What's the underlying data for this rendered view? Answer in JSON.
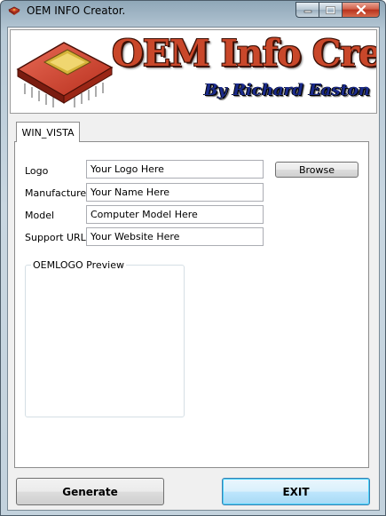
{
  "window": {
    "title": "OEM INFO Creator."
  },
  "banner": {
    "title": "OEM Info Creator",
    "subtitle": "By Richard Easton"
  },
  "tabs": [
    {
      "label": "WIN_VISTA",
      "selected": true
    }
  ],
  "form": {
    "logo": {
      "label": "Logo",
      "value": "Your Logo Here"
    },
    "manufacturer": {
      "label": "Manufacturer",
      "value": "Your Name Here"
    },
    "model": {
      "label": "Model",
      "value": "Computer Model Here"
    },
    "support_url": {
      "label": "Support URL",
      "value": "Your Website Here"
    },
    "browse_label": "Browse"
  },
  "preview": {
    "legend": "OEMLOGO Preview"
  },
  "actions": {
    "generate_label": "Generate",
    "exit_label": "EXIT"
  },
  "icons": {
    "app": "chip-icon",
    "minimize": "minimize-icon",
    "maximize": "maximize-icon",
    "close": "close-icon"
  },
  "colors": {
    "banner_title": "#c9472a",
    "banner_subtitle": "#1a2a8a",
    "close_button": "#c8452c",
    "default_button_border": "#3c7fb1"
  }
}
